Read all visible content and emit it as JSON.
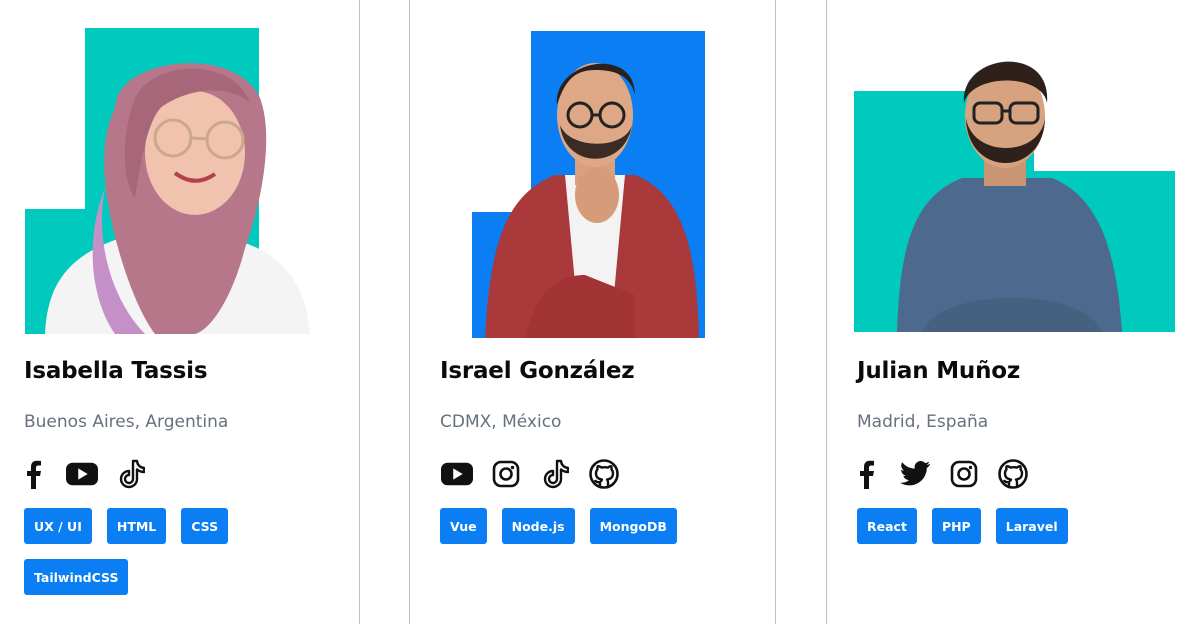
{
  "cards": [
    {
      "name": "Isabella Tassis",
      "location": "Buenos Aires, Argentina",
      "accent": "#00c9be",
      "socials": [
        "facebook-icon",
        "youtube-icon",
        "tiktok-icon"
      ],
      "tags": [
        "UX / UI",
        "HTML",
        "CSS",
        "TailwindCSS"
      ]
    },
    {
      "name": "Israel González",
      "location": "CDMX, México",
      "accent": "#0a7ef2",
      "socials": [
        "youtube-icon",
        "instagram-icon",
        "tiktok-icon",
        "github-icon"
      ],
      "tags": [
        "Vue",
        "Node.js",
        "MongoDB"
      ]
    },
    {
      "name": "Julian Muñoz",
      "location": "Madrid, España",
      "accent": "#00c9be",
      "socials": [
        "facebook-icon",
        "twitter-icon",
        "instagram-icon",
        "github-icon"
      ],
      "tags": [
        "React",
        "PHP",
        "Laravel"
      ]
    }
  ]
}
